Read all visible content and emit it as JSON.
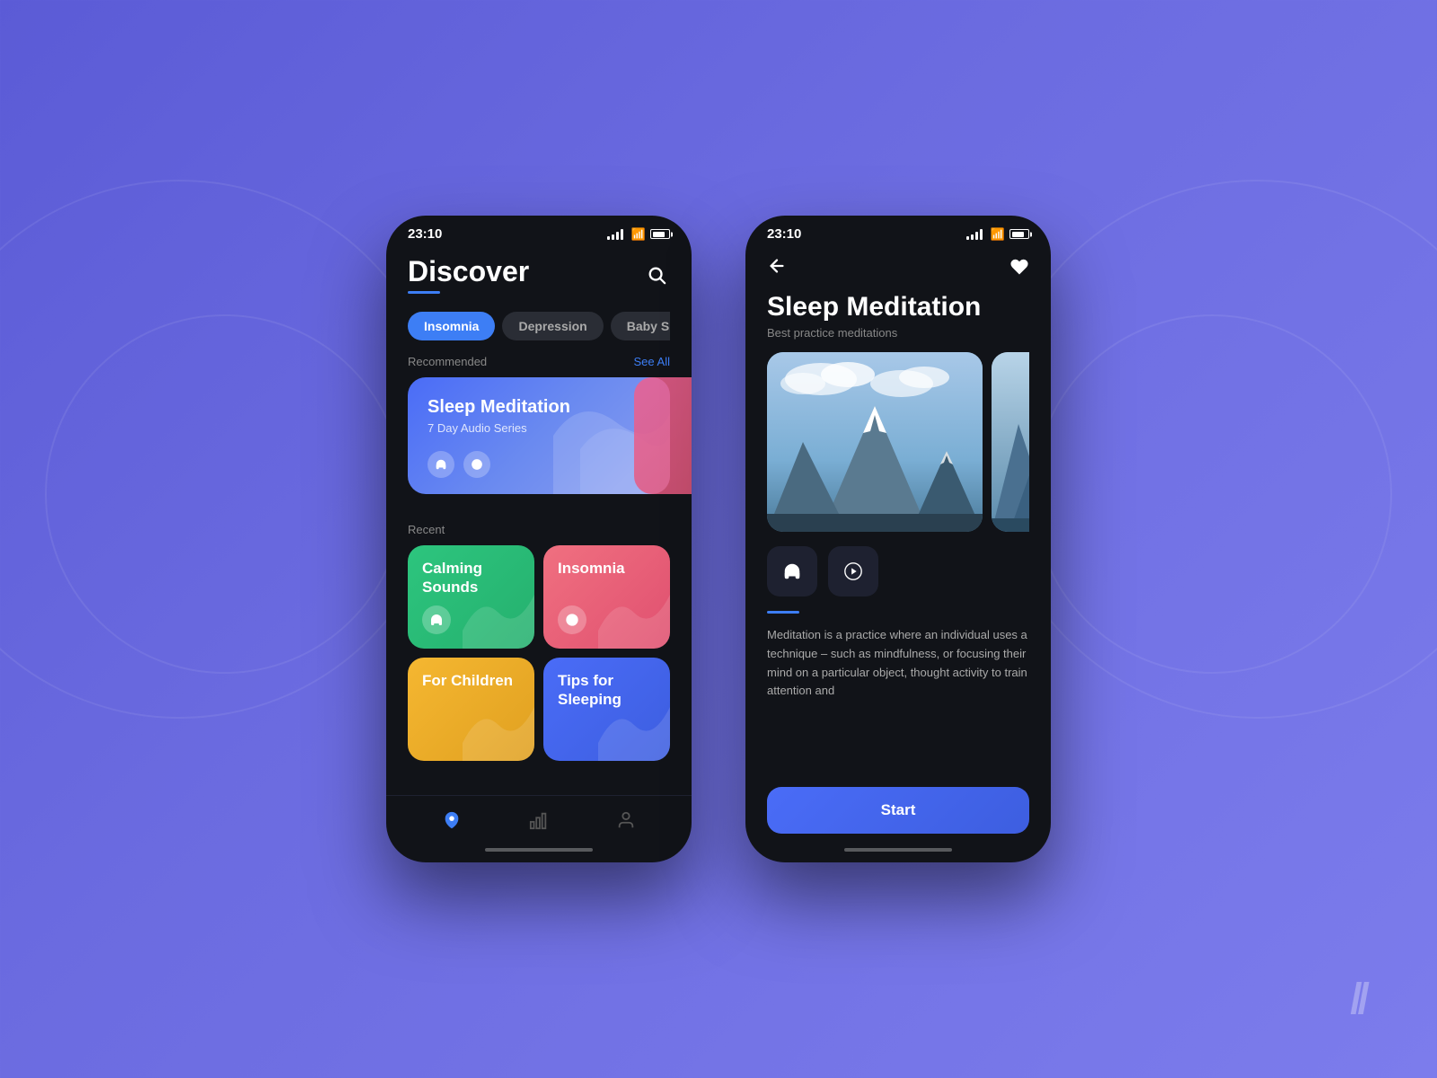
{
  "background": {
    "color": "#6366e8"
  },
  "slash_mark": "//",
  "phone1": {
    "status_bar": {
      "time": "23:10"
    },
    "header": {
      "title": "Discover",
      "search_label": "search"
    },
    "filters": [
      {
        "label": "Insomnia",
        "active": true
      },
      {
        "label": "Depression",
        "active": false
      },
      {
        "label": "Baby Sleep",
        "active": false
      }
    ],
    "recommended": {
      "label": "Recommended",
      "see_all": "See All",
      "card": {
        "title": "Sleep Meditation",
        "subtitle": "7 Day Audio Series",
        "icons": [
          "headphones",
          "film"
        ]
      }
    },
    "recent": {
      "label": "Recent",
      "items": [
        {
          "title": "Calming Sounds",
          "color": "green",
          "icon": "headphones"
        },
        {
          "title": "Insomnia",
          "color": "pink",
          "icon": "film"
        },
        {
          "title": "For Children",
          "color": "yellow",
          "icon": null
        },
        {
          "title": "Tips for Sleeping",
          "color": "blue",
          "icon": null
        }
      ]
    },
    "nav": [
      {
        "icon": "compass",
        "active": true
      },
      {
        "icon": "bar-chart",
        "active": false
      },
      {
        "icon": "person",
        "active": false
      }
    ]
  },
  "phone2": {
    "status_bar": {
      "time": "23:10"
    },
    "header": {
      "back_label": "back",
      "heart_label": "favorite"
    },
    "title": "Sleep Meditation",
    "subtitle": "Best practice meditations",
    "media": {
      "images": [
        "mountain-landscape",
        "mountain-landscape-2"
      ]
    },
    "media_buttons": [
      "headphones",
      "film"
    ],
    "description": "Meditation is a practice where an individual uses a technique – such as mindfulness, or focusing their mind on a particular object, thought activity to train attention and",
    "start_button": "Start"
  }
}
